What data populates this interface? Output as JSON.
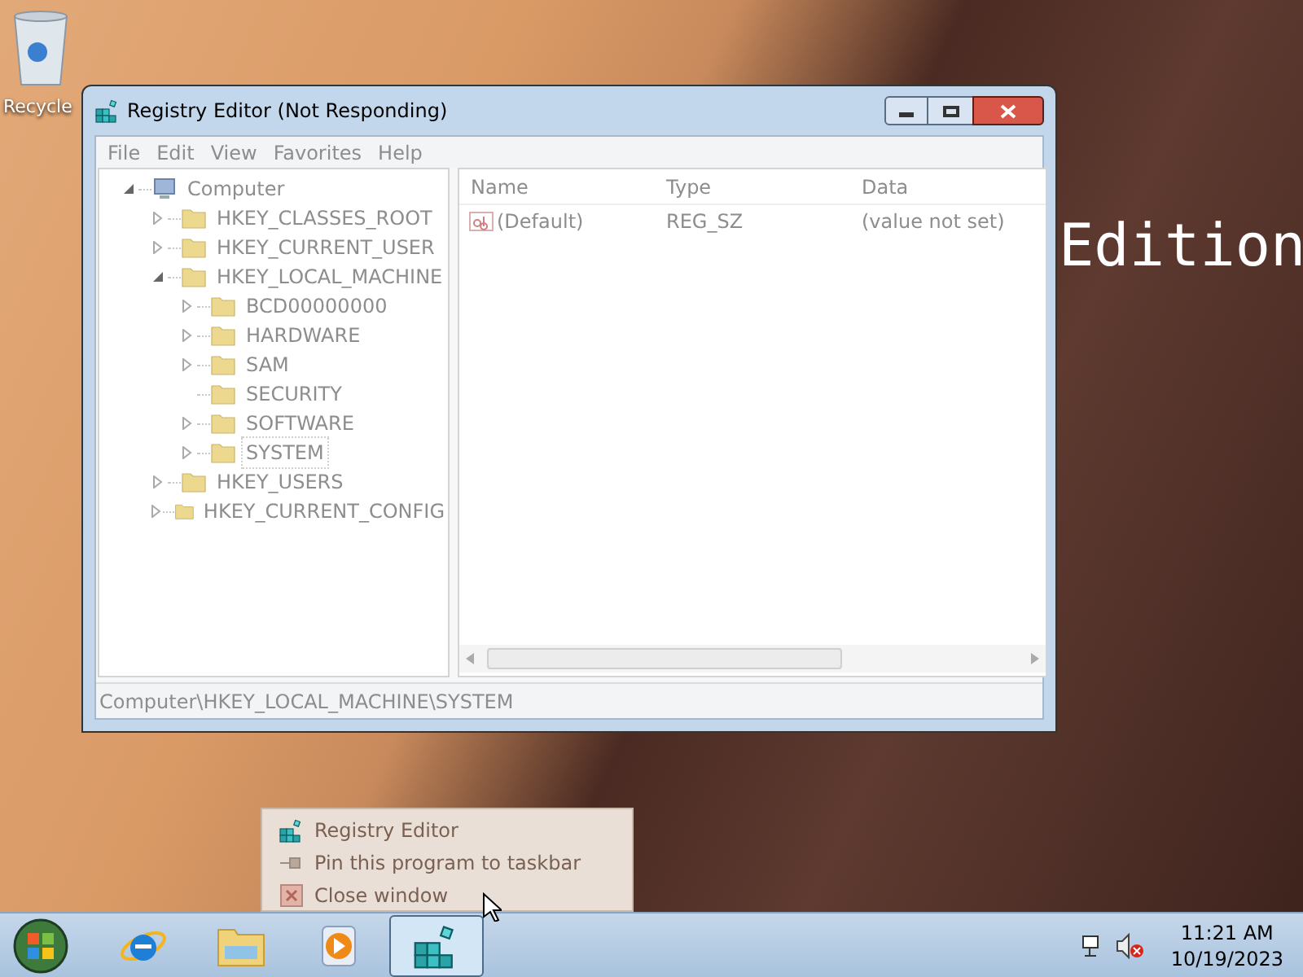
{
  "desktop": {
    "icons": [
      {
        "label": "Recycle"
      }
    ],
    "wallpaper_text": "Edition"
  },
  "window": {
    "title": "Registry Editor (Not Responding)",
    "menu": [
      {
        "label": "File"
      },
      {
        "label": "Edit"
      },
      {
        "label": "View"
      },
      {
        "label": "Favorites"
      },
      {
        "label": "Help"
      }
    ],
    "tree": [
      {
        "label": "Computer",
        "kind": "computer",
        "expanded": true,
        "selected": false,
        "children": [
          {
            "label": "HKEY_CLASSES_ROOT",
            "kind": "folder",
            "expanded": false,
            "selected": false
          },
          {
            "label": "HKEY_CURRENT_USER",
            "kind": "folder",
            "expanded": false,
            "selected": false
          },
          {
            "label": "HKEY_LOCAL_MACHINE",
            "kind": "folder",
            "expanded": true,
            "selected": false,
            "children": [
              {
                "label": "BCD00000000",
                "kind": "folder",
                "expanded": false,
                "selected": false
              },
              {
                "label": "HARDWARE",
                "kind": "folder",
                "expanded": false,
                "selected": false
              },
              {
                "label": "SAM",
                "kind": "folder",
                "expanded": false,
                "selected": false
              },
              {
                "label": "SECURITY",
                "kind": "leaf",
                "selected": false
              },
              {
                "label": "SOFTWARE",
                "kind": "folder",
                "expanded": false,
                "selected": false
              },
              {
                "label": "SYSTEM",
                "kind": "folder",
                "expanded": false,
                "selected": true
              }
            ]
          },
          {
            "label": "HKEY_USERS",
            "kind": "folder",
            "expanded": false,
            "selected": false
          },
          {
            "label": "HKEY_CURRENT_CONFIG",
            "kind": "folder",
            "expanded": false,
            "selected": false
          }
        ]
      }
    ],
    "columns": [
      "Name",
      "Type",
      "Data"
    ],
    "rows": [
      {
        "name": "(Default)",
        "type": "REG_SZ",
        "data": "(value not set)"
      }
    ],
    "status_bar": "Computer\\HKEY_LOCAL_MACHINE\\SYSTEM"
  },
  "jump_list": [
    {
      "label": "Registry Editor",
      "kind": "app"
    },
    {
      "label": "Pin this program to taskbar",
      "kind": "pin"
    },
    {
      "label": "Close window",
      "kind": "close"
    }
  ],
  "taskbar": {
    "items": [
      {
        "kind": "ie",
        "selected": false
      },
      {
        "kind": "explorer",
        "selected": false
      },
      {
        "kind": "media",
        "selected": false
      },
      {
        "kind": "regedit",
        "selected": true
      }
    ],
    "time": "11:21 AM",
    "date": "10/19/2023"
  }
}
